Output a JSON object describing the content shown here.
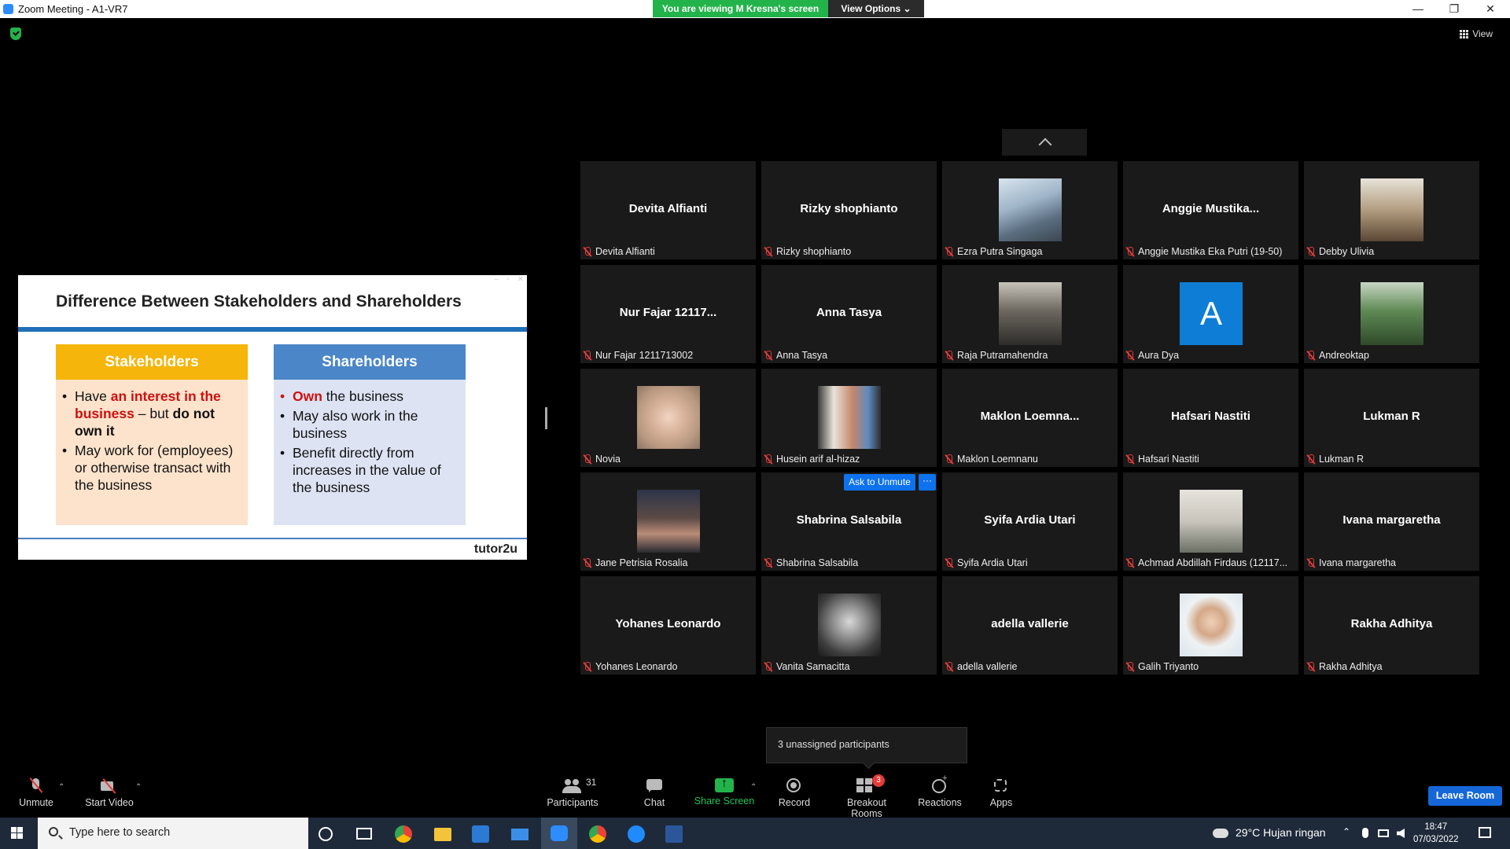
{
  "window": {
    "title": "Zoom Meeting - A1-VR7",
    "viewing_banner": "You are viewing M Kresna's screen",
    "view_options": "View Options",
    "view_options_caret": "⌄",
    "minimize": "—",
    "restore": "❐",
    "close": "✕"
  },
  "top_right": {
    "view_label": "View"
  },
  "slide": {
    "title": "Difference Between Stakeholders and Shareholders",
    "stakeholders_title": "Stakeholders",
    "shareholders_title": "Shareholders",
    "s1_a": "Have ",
    "s1_b": "an interest in the business",
    "s1_c": " – but ",
    "s1_d": "do not own it",
    "s2": "May work for (employees) or otherwise transact with the business",
    "h1_a": "Own",
    "h1_b": " the business",
    "h2": "May also work in the business",
    "h3": "Benefit directly from increases in the value of the business",
    "logo": "tutor2u",
    "ctrl_min": "–",
    "ctrl_restore": "▫",
    "ctrl_close": "✕",
    "colors": {
      "stakeholders_head": "#f5b50a",
      "stakeholders_body": "#fde3cc",
      "shareholders_head": "#4a86c8",
      "shareholders_body": "#dde3f3"
    }
  },
  "participants": [
    {
      "big": "Devita Alfianti",
      "label": "Devita Alfianti"
    },
    {
      "big": "Rizky shophianto",
      "label": "Rizky shophianto"
    },
    {
      "photo": "building-photo",
      "label": "Ezra Putra Singaga"
    },
    {
      "big": "Anggie  Mustika...",
      "label": "Anggie Mustika Eka Putri (19-50)"
    },
    {
      "photo": "debby-photo",
      "label": "Debby Ulivia"
    },
    {
      "big": "Nur Fajar 12117...",
      "label": "Nur Fajar 1211713002"
    },
    {
      "big": "Anna Tasya",
      "label": "Anna Tasya"
    },
    {
      "photo": "raja-photo",
      "label": "Raja Putramahendra"
    },
    {
      "avatar": "A",
      "label": "Aura Dya"
    },
    {
      "photo": "andre-photo",
      "label": "Andreoktap"
    },
    {
      "photo": "novia-photo",
      "label": "Novia"
    },
    {
      "photo": "husein-photo",
      "label": "Husein arif al-hizaz"
    },
    {
      "big": "Maklon  Loemna...",
      "label": "Maklon Loemnanu"
    },
    {
      "big": "Hafsari Nastiti",
      "label": "Hafsari Nastiti"
    },
    {
      "big": "Lukman R",
      "label": "Lukman R"
    },
    {
      "photo": "jane-photo",
      "label": "Jane Petrisia Rosalia"
    },
    {
      "big": "Shabrina Salsabila",
      "label": "Shabrina Salsabila"
    },
    {
      "big": "Syifa Ardia Utari",
      "label": "Syifa Ardia Utari"
    },
    {
      "photo": "achmad-photo",
      "label": "Achmad Abdillah Firdaus (12117..."
    },
    {
      "big": "Ivana margaretha",
      "label": "Ivana margaretha"
    },
    {
      "big": "Yohanes Leonardo",
      "label": "Yohanes Leonardo"
    },
    {
      "photo": "vanita-photo",
      "label": "Vanita Samacitta"
    },
    {
      "big": "adella vallerie",
      "label": "adella vallerie"
    },
    {
      "photo": "galih-photo",
      "label": "Galih Triyanto"
    },
    {
      "big": "Rakha Adhitya",
      "label": "Rakha Adhitya"
    }
  ],
  "ask_unmute": {
    "label": "Ask to Unmute",
    "more": "···"
  },
  "popup": {
    "unassigned": "3 unassigned participants"
  },
  "toolbar": {
    "unmute": "Unmute",
    "start_video": "Start Video",
    "participants": "Participants",
    "participants_count": "31",
    "chat": "Chat",
    "share_screen": "Share Screen",
    "record": "Record",
    "breakout_rooms": "Breakout Rooms",
    "breakout_badge": "3",
    "reactions": "Reactions",
    "apps": "Apps",
    "leave": "Leave Room",
    "caret": "⌃"
  },
  "taskbar": {
    "search_placeholder": "Type here to search",
    "weather": "29°C  Hujan ringan",
    "time": "18:47",
    "date": "07/03/2022"
  }
}
